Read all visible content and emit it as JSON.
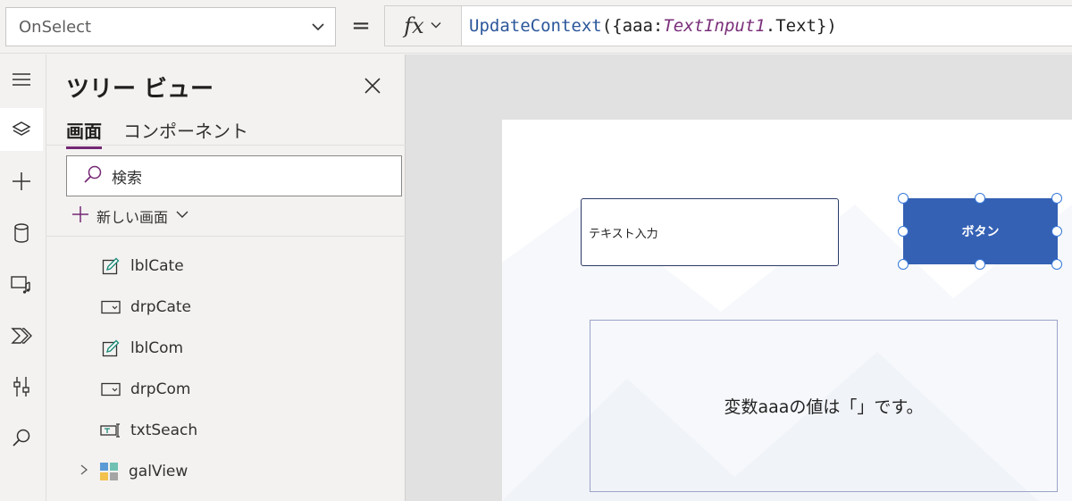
{
  "formula_bar": {
    "property": "OnSelect",
    "equals": "=",
    "fx": "fx",
    "formula": {
      "fn": "UpdateContext",
      "open": "({aaa:",
      "ref": "TextInput1",
      "close": ".Text})"
    }
  },
  "tree_view": {
    "title": "ツリー ビュー",
    "tabs": [
      "画面",
      "コンポーネント"
    ],
    "search_placeholder": "検索",
    "new_screen": "新しい画面",
    "items": [
      {
        "label": "lblCate",
        "icon": "edit-label-icon"
      },
      {
        "label": "drpCate",
        "icon": "dropdown-icon"
      },
      {
        "label": "lblCom",
        "icon": "edit-label-icon"
      },
      {
        "label": "drpCom",
        "icon": "dropdown-icon"
      },
      {
        "label": "txtSeach",
        "icon": "text-input-icon"
      },
      {
        "label": "galView",
        "icon": "gallery-icon"
      }
    ]
  },
  "canvas": {
    "text_input_value": "テキスト入力",
    "button_label": "ボタン",
    "label_text": "変数aaaの値は「」です。"
  },
  "colors": {
    "accent": "#742774",
    "button": "#3461b4",
    "selection_handle": "#3778d8"
  }
}
